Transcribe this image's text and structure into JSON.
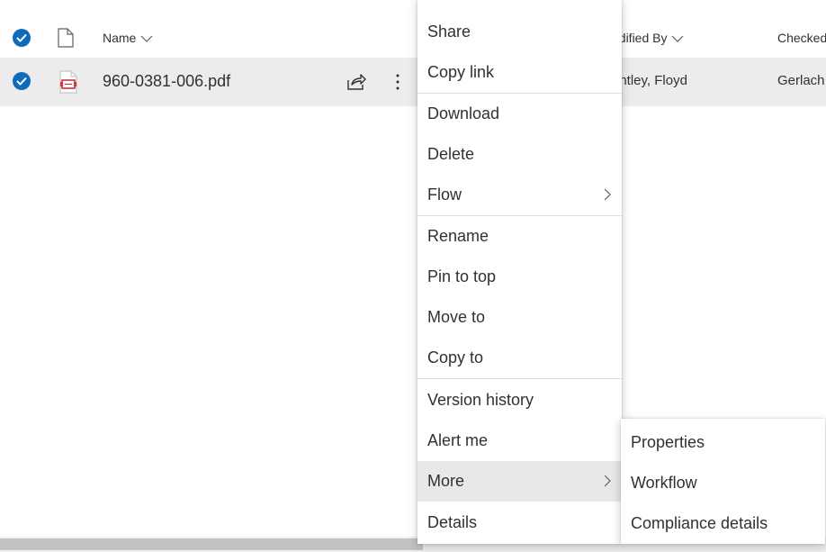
{
  "header": {
    "name_label": "Name",
    "modified_by_label": "odified By",
    "checked_out_label": "Checked"
  },
  "row": {
    "file_name": "960-0381-006.pdf",
    "modified_by": "antley, Floyd",
    "checked_out_to": "Gerlach,"
  },
  "context_menu": {
    "items": [
      {
        "label": "Share"
      },
      {
        "label": "Copy link"
      },
      {
        "label": "Download"
      },
      {
        "label": "Delete"
      },
      {
        "label": "Flow"
      },
      {
        "label": "Rename"
      },
      {
        "label": "Pin to top"
      },
      {
        "label": "Move to"
      },
      {
        "label": "Copy to"
      },
      {
        "label": "Version history"
      },
      {
        "label": "Alert me"
      },
      {
        "label": "More"
      },
      {
        "label": "Details"
      }
    ]
  },
  "submenu": {
    "items": [
      {
        "label": "Properties"
      },
      {
        "label": "Workflow"
      },
      {
        "label": "Compliance details"
      }
    ]
  },
  "colors": {
    "accent": "#0f6cbd",
    "row_selected_bg": "#ececec",
    "menu_hover_bg": "#e8e8e8",
    "pdf_icon": "#d13438"
  },
  "icons": [
    "select-all-check-icon",
    "file-type-icon",
    "chevron-down-icon",
    "row-check-icon",
    "pdf-icon",
    "share-icon",
    "more-vertical-icon",
    "chevron-right-icon"
  ]
}
